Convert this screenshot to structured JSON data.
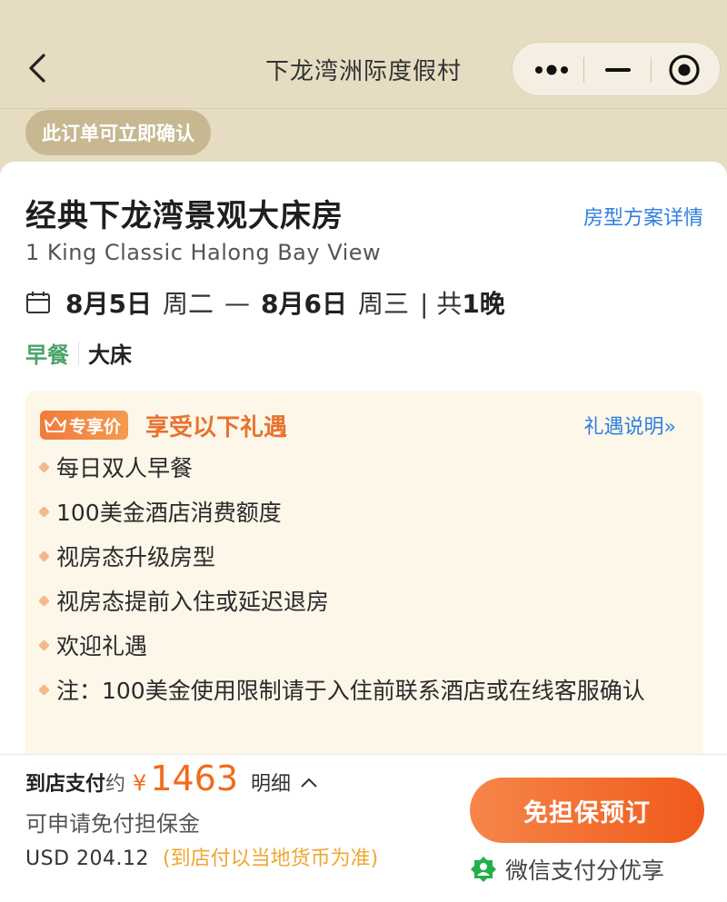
{
  "nav": {
    "title": "下龙湾洲际度假村",
    "back_icon": "chevron-left-icon",
    "more_icon": "more-dots-icon",
    "minimize_icon": "minus-icon",
    "close_icon": "target-circle-icon"
  },
  "confirm_badge": "此订单可立即确认",
  "room": {
    "title": "经典下龙湾景观大床房",
    "detail_link": "房型方案详情",
    "title_en": "1 King Classic Halong Bay View",
    "checkin_date": "8月5日",
    "checkin_weekday": "周二",
    "dash": "—",
    "checkout_date": "8月6日",
    "checkout_weekday": "周三",
    "nights_prefix": "| 共",
    "nights_count": "1晚",
    "tag_breakfast": "早餐",
    "tag_bed": "大床"
  },
  "perks": {
    "badge": "专享价",
    "heading": "享受以下礼遇",
    "link": "礼遇说明»",
    "items": [
      "每日双人早餐",
      "100美金酒店消费额度",
      "视房态升级房型",
      "视房态提前入住或延迟退房",
      "欢迎礼遇",
      "注：100美金使用限制请于入住前联系酒店或在线客服确认"
    ]
  },
  "bottom": {
    "price_label": "到店支付",
    "price_approx": "约",
    "currency": "¥",
    "price": "1463",
    "detail": "明细",
    "guarantee": "可申请免付担保金",
    "usd": "USD 204.12",
    "usd_note": "(到店付以当地货币为准)",
    "book_button": "免担保预订",
    "wechat": "微信支付分优享"
  },
  "colors": {
    "accent_orange": "#f26a1b",
    "link_blue": "#2f7fe0",
    "green": "#4aa368",
    "header_bg": "#e6dcc2"
  }
}
